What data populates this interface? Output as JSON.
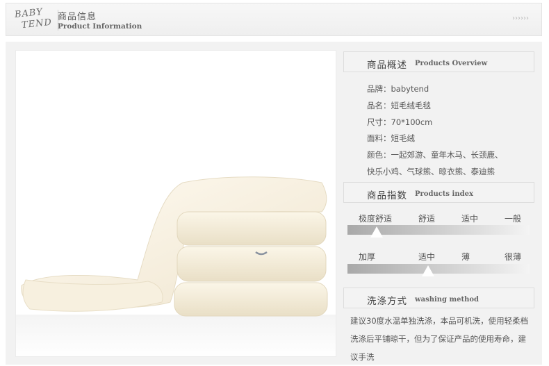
{
  "header": {
    "logo_line1": "BABY",
    "logo_line2": "TEND",
    "title_cn": "商品信息",
    "title_en": "Product Information",
    "arrows": "››››››"
  },
  "overview": {
    "title_cn": "商品概述",
    "title_en": "Products Overview",
    "specs": [
      "品牌：babytend",
      "品名：短毛绒毛毯",
      "尺寸：70*100cm",
      "面料：短毛绒",
      "颜色：一起郊游、童年木马、长颈鹿、",
      "快乐小鸡、气球熊、晾衣熊、泰迪熊"
    ]
  },
  "index": {
    "title_cn": "商品指数",
    "title_en": "Products index",
    "comfort": {
      "labels": [
        "极度舒适",
        "舒适",
        "适中",
        "一般"
      ],
      "selected": "极度舒适"
    },
    "thickness": {
      "labels": [
        "加厚",
        "适中",
        "薄",
        "很薄"
      ],
      "selected": "适中"
    }
  },
  "washing": {
    "title_cn": "洗涤方式",
    "title_en": "washing method",
    "text": "建议30度水温单独洗涤，本品可机洗，使用轻柔档洗涤后平铺晾干，但为了保证产品的使用寿命，建议手洗"
  }
}
